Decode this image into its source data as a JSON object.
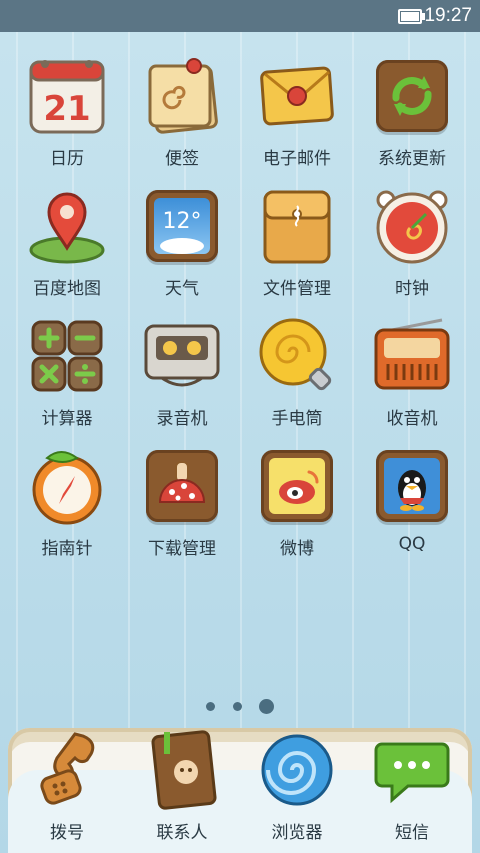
{
  "status_bar": {
    "time": "19:27"
  },
  "apps": [
    {
      "label": "日历",
      "icon": "calendar-icon",
      "text": "21"
    },
    {
      "label": "便签",
      "icon": "notes-icon"
    },
    {
      "label": "电子邮件",
      "icon": "email-icon"
    },
    {
      "label": "系统更新",
      "icon": "system-update-icon"
    },
    {
      "label": "百度地图",
      "icon": "map-pin-icon"
    },
    {
      "label": "天气",
      "icon": "weather-icon",
      "text": "12°"
    },
    {
      "label": "文件管理",
      "icon": "folder-icon"
    },
    {
      "label": "时钟",
      "icon": "clock-icon"
    },
    {
      "label": "计算器",
      "icon": "calculator-icon"
    },
    {
      "label": "录音机",
      "icon": "cassette-icon"
    },
    {
      "label": "手电筒",
      "icon": "flashlight-bulb-icon"
    },
    {
      "label": "收音机",
      "icon": "radio-icon"
    },
    {
      "label": "指南针",
      "icon": "compass-icon"
    },
    {
      "label": "下载管理",
      "icon": "download-mushroom-icon"
    },
    {
      "label": "微博",
      "icon": "weibo-icon"
    },
    {
      "label": "QQ",
      "icon": "qq-penguin-icon"
    }
  ],
  "page_indicator": {
    "count": 3,
    "active": 3
  },
  "dock": [
    {
      "label": "拨号",
      "icon": "phone-icon"
    },
    {
      "label": "联系人",
      "icon": "contacts-book-icon"
    },
    {
      "label": "浏览器",
      "icon": "browser-icon"
    },
    {
      "label": "短信",
      "icon": "message-bubble-icon"
    }
  ],
  "colors": {
    "statusbar": "#5b7585",
    "wallpaper": "#b9dbe8",
    "wood": "#8a5a2e",
    "accent_red": "#d9453a",
    "accent_yellow": "#f4c64a"
  }
}
